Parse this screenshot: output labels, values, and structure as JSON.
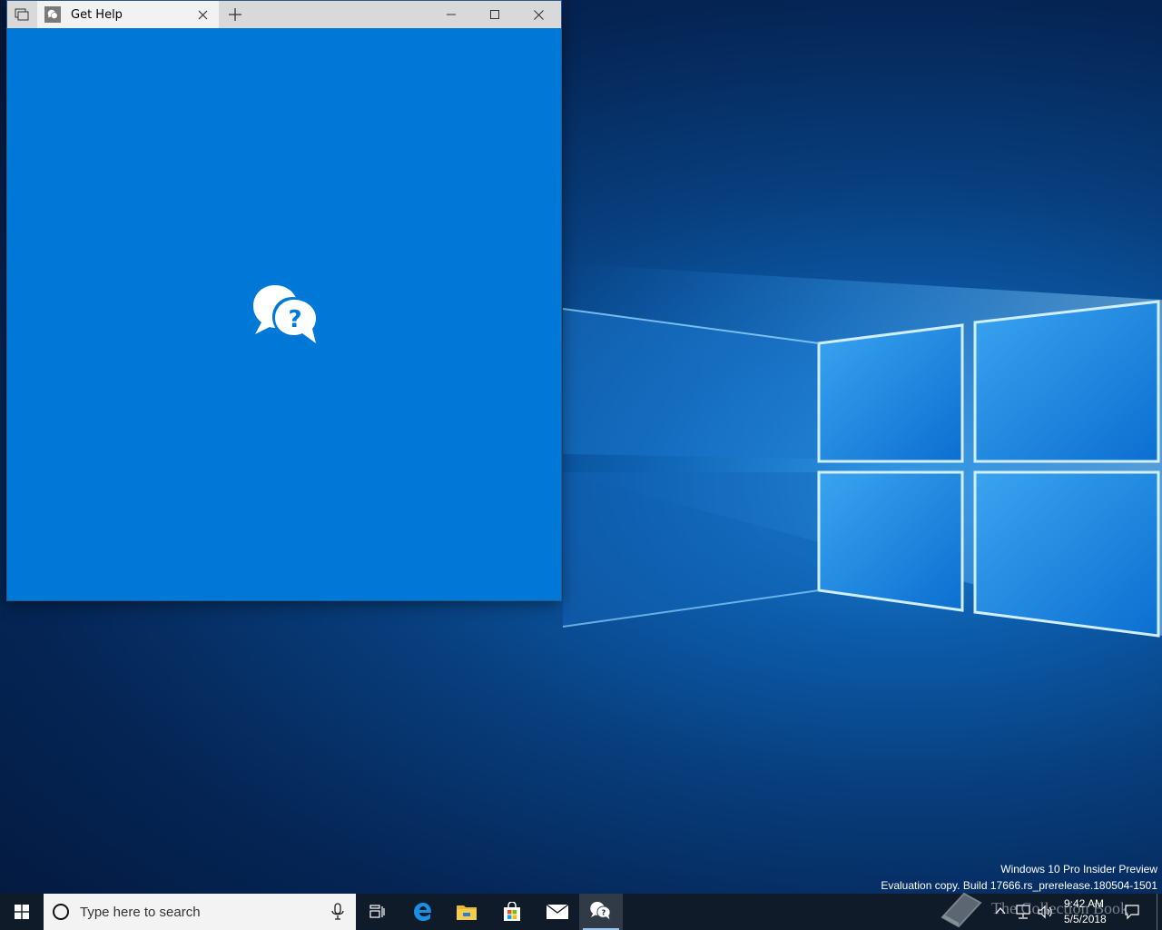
{
  "window": {
    "tab_title": "Get Help",
    "app_icon": "get-help-icon"
  },
  "desktop": {
    "watermark_line1": "Windows 10 Pro Insider Preview",
    "watermark_line2": "Evaluation copy. Build 17666.rs_prerelease.180504-1501"
  },
  "taskbar": {
    "search_placeholder": "Type here to search",
    "time": "9:42 AM",
    "date": "5/5/2018",
    "pinned": [
      "task-view-icon",
      "edge-icon",
      "file-explorer-icon",
      "store-icon",
      "mail-icon",
      "get-help-icon"
    ]
  },
  "overlay": {
    "text": "The Collection Book"
  },
  "colors": {
    "app_accent": "#0078d7",
    "taskbar": "#101b2a",
    "titlebar": "#d9d9d9"
  }
}
